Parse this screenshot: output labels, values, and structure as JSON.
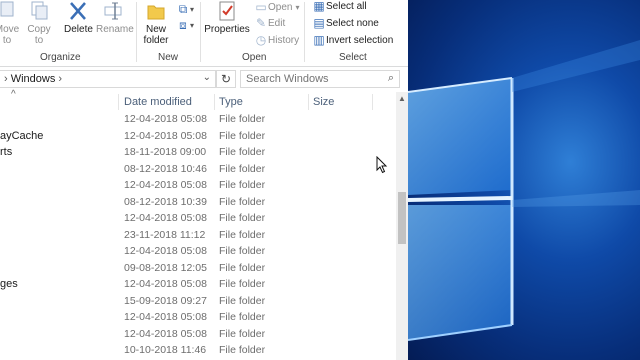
{
  "ribbon": {
    "move_to": "Move\nto",
    "copy_to": "Copy\nto",
    "delete": "Delete",
    "rename": "Rename",
    "new_folder": "New\nfolder",
    "properties": "Properties",
    "open": "Open",
    "edit": "Edit",
    "history": "History",
    "select_all": "Select all",
    "select_none": "Select none",
    "invert_selection": "Invert selection",
    "groups": {
      "organize": "Organize",
      "new": "New",
      "open": "Open",
      "select": "Select"
    }
  },
  "address": {
    "path": "Windows",
    "separator": "›"
  },
  "search": {
    "placeholder": "Search Windows"
  },
  "columns": {
    "date_modified": "Date modified",
    "type": "Type",
    "size": "Size"
  },
  "rows": [
    {
      "name": "",
      "date": "12-04-2018 05:08",
      "type": "File folder"
    },
    {
      "name": "ayCache",
      "date": "12-04-2018 05:08",
      "type": "File folder"
    },
    {
      "name": "rts",
      "date": "18-11-2018 09:00",
      "type": "File folder"
    },
    {
      "name": "",
      "date": "08-12-2018 10:46",
      "type": "File folder"
    },
    {
      "name": "",
      "date": "12-04-2018 05:08",
      "type": "File folder"
    },
    {
      "name": "",
      "date": "08-12-2018 10:39",
      "type": "File folder"
    },
    {
      "name": "",
      "date": "12-04-2018 05:08",
      "type": "File folder"
    },
    {
      "name": "",
      "date": "23-11-2018 11:12",
      "type": "File folder"
    },
    {
      "name": "",
      "date": "12-04-2018 05:08",
      "type": "File folder"
    },
    {
      "name": "",
      "date": "09-08-2018 12:05",
      "type": "File folder"
    },
    {
      "name": "ges",
      "date": "12-04-2018 05:08",
      "type": "File folder"
    },
    {
      "name": "",
      "date": "15-09-2018 09:27",
      "type": "File folder"
    },
    {
      "name": "",
      "date": "12-04-2018 05:08",
      "type": "File folder"
    },
    {
      "name": "",
      "date": "12-04-2018 05:08",
      "type": "File folder"
    },
    {
      "name": "",
      "date": "10-10-2018 11:46",
      "type": "File folder"
    }
  ],
  "colors": {
    "accent": "#3b6fb6",
    "header_text": "#4c607a",
    "desktop_blue": "#0f4aa8"
  },
  "icons": [
    "move-to-icon",
    "copy-to-icon",
    "delete-icon",
    "rename-icon",
    "new-folder-icon",
    "new-item-icon",
    "properties-icon",
    "open-icon",
    "edit-icon",
    "history-icon",
    "select-all-icon",
    "select-none-icon",
    "invert-selection-icon",
    "chevron-down-icon",
    "refresh-icon",
    "search-icon",
    "sort-up-icon",
    "scroll-up-icon",
    "mouse-cursor-icon"
  ]
}
